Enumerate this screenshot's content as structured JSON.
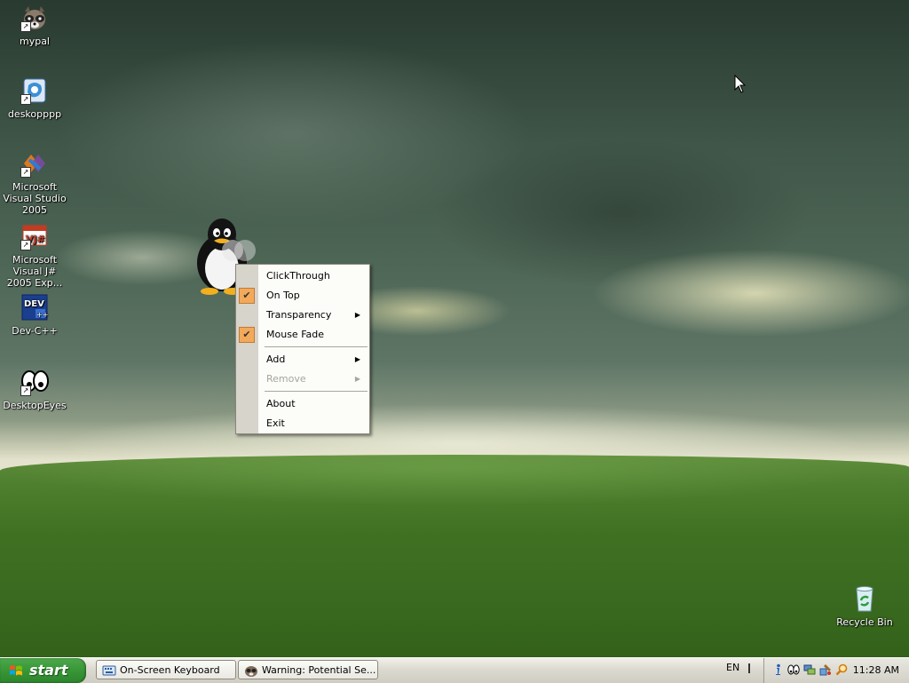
{
  "desktop": {
    "icons": [
      {
        "label": "mypal"
      },
      {
        "label": "deskopppp"
      },
      {
        "label": "Microsoft Visual Studio 2005"
      },
      {
        "label": "Microsoft Visual J# 2005 Exp..."
      },
      {
        "label": "Dev-C++"
      },
      {
        "label": "DesktopEyes"
      },
      {
        "label": "Recycle Bin"
      }
    ]
  },
  "context_menu": {
    "items": [
      {
        "label": "ClickThrough",
        "checked": false,
        "submenu": false,
        "enabled": true
      },
      {
        "label": "On Top",
        "checked": true,
        "submenu": false,
        "enabled": true
      },
      {
        "label": "Transparency",
        "checked": false,
        "submenu": true,
        "enabled": true
      },
      {
        "label": "Mouse Fade",
        "checked": true,
        "submenu": false,
        "enabled": true
      },
      {
        "label": "Add",
        "checked": false,
        "submenu": true,
        "enabled": true
      },
      {
        "label": "Remove",
        "checked": false,
        "submenu": true,
        "enabled": false
      },
      {
        "label": "About",
        "checked": false,
        "submenu": false,
        "enabled": true
      },
      {
        "label": "Exit",
        "checked": false,
        "submenu": false,
        "enabled": true
      }
    ],
    "check_glyph": "✔",
    "arrow_glyph": "▶",
    "check_color": "#f3a95a"
  },
  "taskbar": {
    "start_label": "start",
    "buttons": [
      {
        "label": "On-Screen Keyboard",
        "icon": "keyboard-icon"
      },
      {
        "label": "Warning: Potential Se...",
        "icon": "mypal-icon"
      }
    ],
    "language": "EN",
    "tray_icons": [
      "info-icon",
      "eyes-icon",
      "network-icon",
      "tools-icon",
      "search-icon"
    ],
    "clock": "11:28 AM"
  }
}
